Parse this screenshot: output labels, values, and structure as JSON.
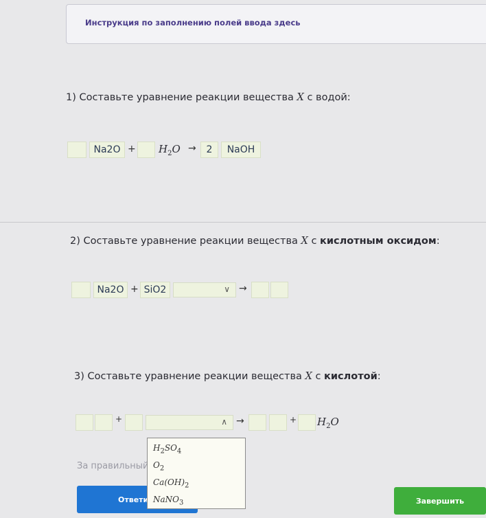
{
  "instruction": "Инструкция по заполнению полей ввода здесь",
  "q1": {
    "prefix": "1) Составьте уравнение реакции вещества ",
    "var": "X",
    "suffix": " с водой:",
    "reagent1": "Na2O",
    "plus": "+",
    "water_base": "H",
    "water_sub": "2",
    "water_tail": "O",
    "arrow": "→",
    "coef_product": "2",
    "product": "NaOH"
  },
  "q2": {
    "prefix": "2) Составьте уравнение реакции вещества ",
    "var": "X",
    "suffix_plain": " с ",
    "suffix_bold": "кислотным оксидом",
    "colon": ":",
    "reagent1": "Na2O",
    "plus": "+",
    "reagent2": "SiO2",
    "select_chevron": "∨",
    "arrow": "→"
  },
  "q3": {
    "prefix": "3) Составьте уравнение реакции вещества ",
    "var": "X",
    "suffix_plain": " с ",
    "suffix_bold": "кислотой",
    "colon": ":",
    "plus": "+",
    "select_chevron": "∧",
    "arrow": "→",
    "plus2": "+",
    "water_base": "H",
    "water_sub": "2",
    "water_tail": "O"
  },
  "dropdown_options": [
    {
      "base": "H",
      "sub1": "2",
      "mid": "SO",
      "sub2": "4"
    },
    {
      "base": "O",
      "sub1": "2",
      "mid": "",
      "sub2": ""
    },
    {
      "base": "Ca(OH)",
      "sub1": "2",
      "mid": "",
      "sub2": ""
    },
    {
      "base": "NaNO",
      "sub1": "3",
      "mid": "",
      "sub2": ""
    }
  ],
  "score_text": "За правильный",
  "answer_button": "Ответи",
  "finish_button": "Завершить"
}
